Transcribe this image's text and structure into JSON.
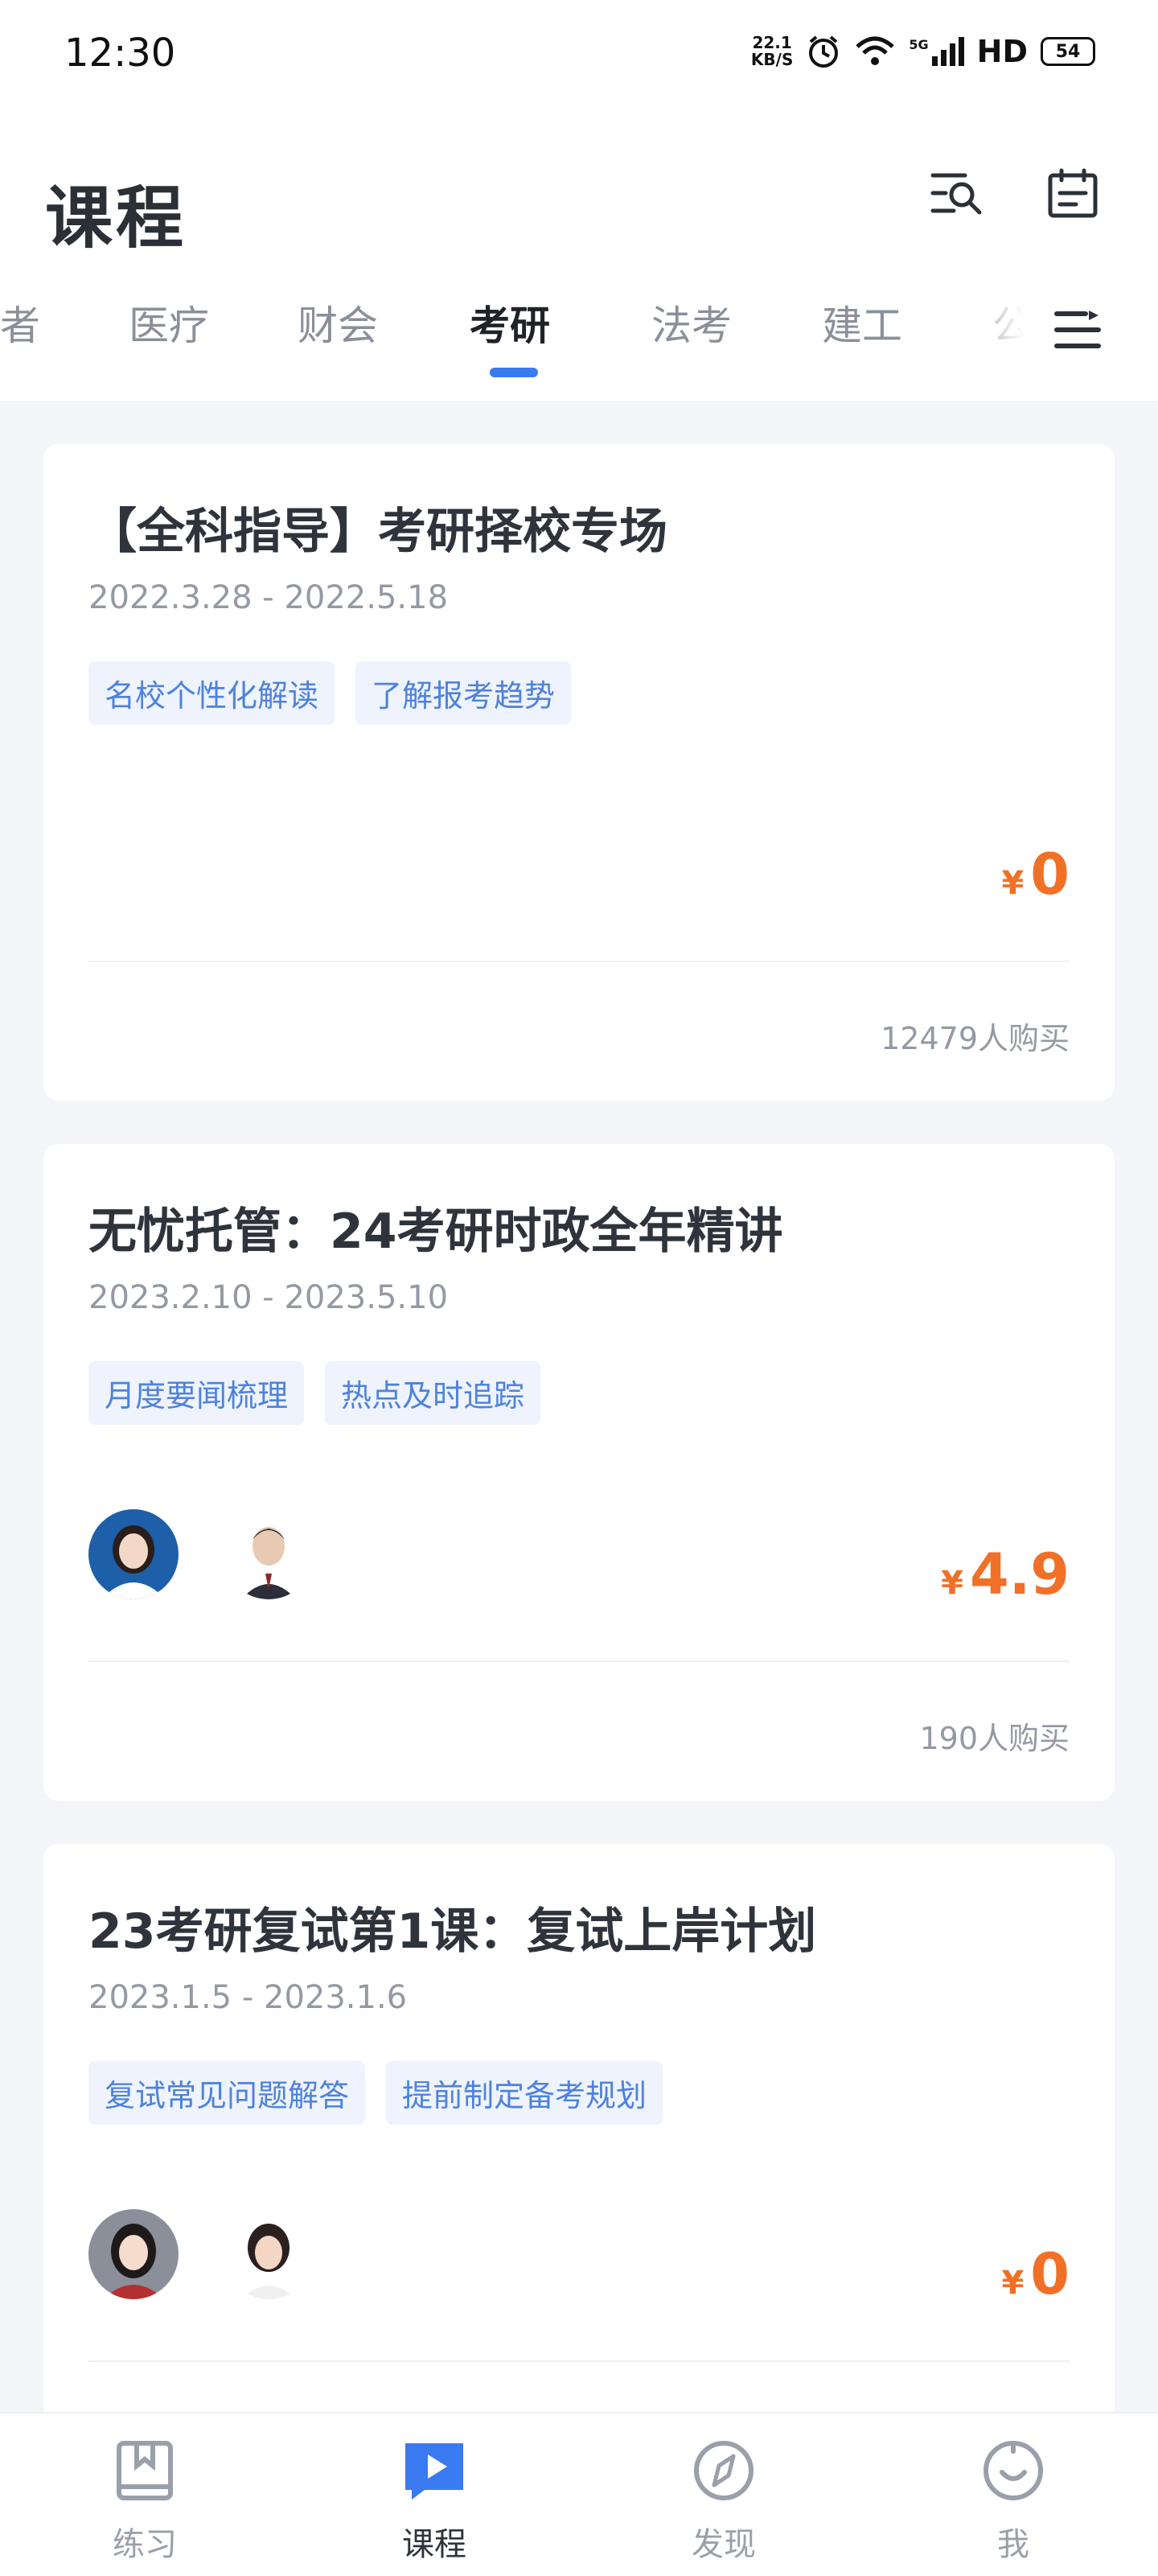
{
  "status_bar": {
    "time": "12:30",
    "net_speed_top": "22.1",
    "net_speed_bottom": "KB/S",
    "network": "5G",
    "hd": "HD",
    "battery": "54"
  },
  "header": {
    "title": "课程"
  },
  "tabs": [
    {
      "label": "者"
    },
    {
      "label": "医疗"
    },
    {
      "label": "财会"
    },
    {
      "label": "考研"
    },
    {
      "label": "法考"
    },
    {
      "label": "建工"
    },
    {
      "label": "公"
    }
  ],
  "active_tab": "考研",
  "courses": [
    {
      "title": "【全科指导】考研择校专场",
      "date": "2022.3.28 - 2022.5.18",
      "tags": [
        "名校个性化解读",
        "了解报考趋势"
      ],
      "currency": "¥",
      "price": "0",
      "buyers": "12479人购买"
    },
    {
      "title": "无忧托管：24考研时政全年精讲",
      "date": "2023.2.10 - 2023.5.10",
      "tags": [
        "月度要闻梳理",
        "热点及时追踪"
      ],
      "currency": "¥",
      "price": "4.9",
      "buyers": "190人购买"
    },
    {
      "title": "23考研复试第1课：复试上岸计划",
      "date": "2023.1.5 - 2023.1.6",
      "tags": [
        "复试常见问题解答",
        "提前制定备考规划"
      ],
      "currency": "¥",
      "price": "0",
      "buyers": ""
    }
  ],
  "bottom_nav": [
    {
      "label": "练习",
      "icon": "book-icon"
    },
    {
      "label": "课程",
      "icon": "play-icon"
    },
    {
      "label": "发现",
      "icon": "compass-icon"
    },
    {
      "label": "我",
      "icon": "profile-icon"
    }
  ],
  "colors": {
    "accent": "#3a7af0",
    "price": "#f07028",
    "tag_bg": "#eef3fd",
    "tag_text": "#4e82dc"
  }
}
